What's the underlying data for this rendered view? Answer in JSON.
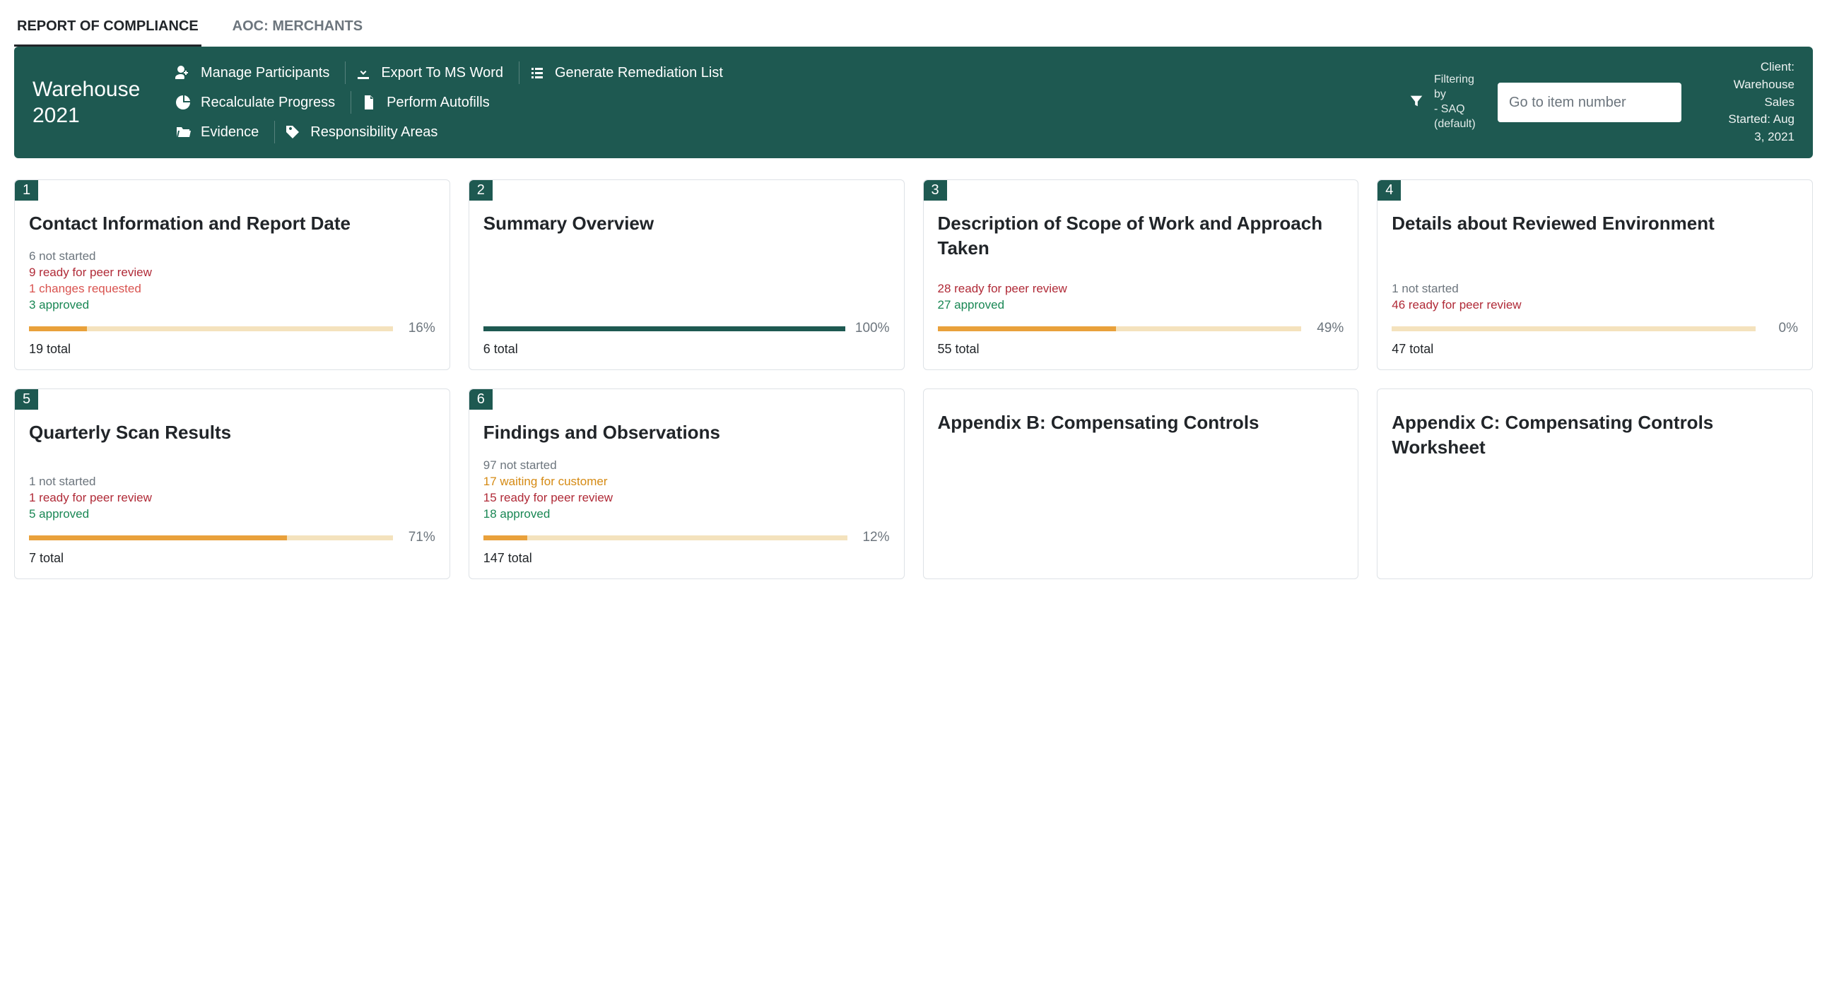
{
  "tabs": {
    "roc": "REPORT OF COMPLIANCE",
    "aoc": "AOC: MERCHANTS"
  },
  "banner": {
    "title": "Warehouse 2021",
    "actions": {
      "manage": "Manage Participants",
      "recalc": "Recalculate Progress",
      "evidence": "Evidence",
      "export": "Export To MS Word",
      "autofill": "Perform Autofills",
      "responsibility": "Responsibility Areas",
      "remediation": "Generate Remediation List"
    },
    "filter_lines": {
      "l1": "Filtering",
      "l2": "by",
      "l3": "- SAQ",
      "l4": "(default)"
    },
    "goto_placeholder": "Go to item number",
    "client_lines": {
      "l1": "Client:",
      "l2": "Warehouse",
      "l3": "Sales",
      "l4": "Started: Aug",
      "l5": "3, 2021"
    }
  },
  "cards": {
    "c1": {
      "num": "1",
      "title": "Contact Information and Report Date",
      "notstarted": "6 not started",
      "peer": "9 ready for peer review",
      "changes": "1 changes requested",
      "approved": "3 approved",
      "pct": "16%",
      "pct_val": 16,
      "bar": "orange",
      "total": "19 total"
    },
    "c2": {
      "num": "2",
      "title": "Summary Overview",
      "pct": "100%",
      "pct_val": 100,
      "bar": "green",
      "total": "6 total"
    },
    "c3": {
      "num": "3",
      "title": "Description of Scope of Work and Approach Taken",
      "peer": "28 ready for peer review",
      "approved": "27 approved",
      "pct": "49%",
      "pct_val": 49,
      "bar": "orange",
      "total": "55 total"
    },
    "c4": {
      "num": "4",
      "title": "Details about Reviewed Environment",
      "notstarted": "1 not started",
      "peer": "46 ready for peer review",
      "pct": "0%",
      "pct_val": 0,
      "bar": "orange",
      "total": "47 total"
    },
    "c5": {
      "num": "5",
      "title": "Quarterly Scan Results",
      "notstarted": "1 not started",
      "peer": "1 ready for peer review",
      "approved": "5 approved",
      "pct": "71%",
      "pct_val": 71,
      "bar": "orange",
      "total": "7 total"
    },
    "c6": {
      "num": "6",
      "title": "Findings and Observations",
      "notstarted": "97 not started",
      "waiting": "17 waiting for customer",
      "peer": "15 ready for peer review",
      "approved": "18 approved",
      "pct": "12%",
      "pct_val": 12,
      "bar": "orange",
      "total": "147 total"
    },
    "c7": {
      "title": "Appendix B: Compensating Controls"
    },
    "c8": {
      "title": "Appendix C: Compensating Controls Worksheet"
    }
  }
}
